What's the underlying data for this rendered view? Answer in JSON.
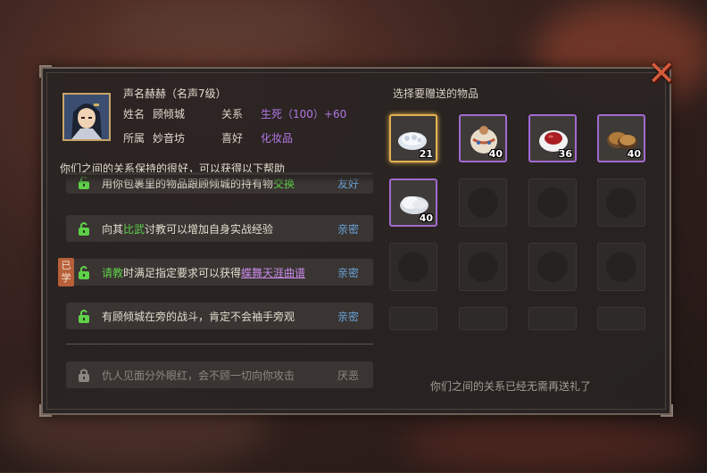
{
  "header": {
    "reputation": "声名赫赫（名声7级）",
    "name_label": "姓名",
    "name_value": "顾倾城",
    "relation_label": "关系",
    "relation_value": "生死（100）+60",
    "faction_label": "所属",
    "faction_value": "妙音坊",
    "hobby_label": "喜好",
    "hobby_value": "化妆品"
  },
  "intro_text": "你们之间的关系保持的很好，可以获得以下帮助",
  "benefits": [
    {
      "pre": "用你包裹里的物品跟顾倾城的持有物",
      "hl": "交换",
      "post": "",
      "tier": "友好"
    },
    {
      "pre": "向其",
      "hl": "比武",
      "post": "讨教可以增加自身实战经验",
      "tier": "亲密"
    },
    {
      "pre": "",
      "hl": "请教",
      "post": "时满足指定要求可以获得",
      "link": "蝶舞天涯曲谱",
      "tier": "亲密"
    },
    {
      "pre": "有顾倾城在旁的战斗，肯定不会袖手旁观",
      "hl": "",
      "post": "",
      "tier": "亲密"
    },
    {
      "pre": "仇人见面分外眼红，会不顾一切向你攻击",
      "hl": "",
      "post": "",
      "tier": "厌恶"
    }
  ],
  "learned_tag": "已学",
  "gift": {
    "title": "选择要赠送的物品",
    "items": [
      {
        "icon": "pearl-powder-icon",
        "count": "21"
      },
      {
        "icon": "painted-porcelain-jar-icon",
        "count": "40"
      },
      {
        "icon": "rouge-dish-icon",
        "count": "36"
      },
      {
        "icon": "cakes-icon",
        "count": "40"
      },
      {
        "icon": "white-powder-icon",
        "count": "40"
      }
    ],
    "footer": "你们之间的关系已经无需再送礼了"
  },
  "colors": {
    "accent_purple": "#b277e6",
    "tier_blue": "#6aa2d8",
    "highlight_green": "#5fd04a",
    "close_red": "#d45a3a"
  }
}
